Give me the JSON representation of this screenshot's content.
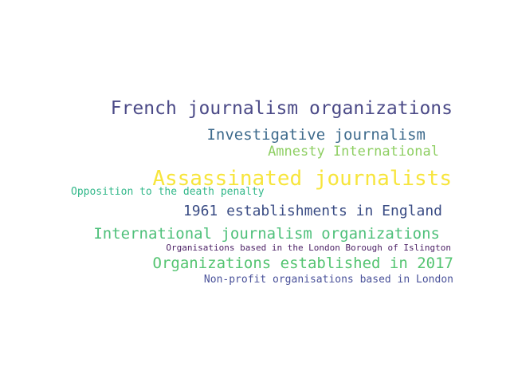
{
  "words": [
    {
      "text": "French journalism organizations",
      "color": "#4b4a87"
    },
    {
      "text": "Investigative journalism",
      "color": "#3d6a8c"
    },
    {
      "text": "Amnesty International",
      "color": "#8fcf64"
    },
    {
      "text": "Assassinated journalists",
      "color": "#f7e53c"
    },
    {
      "text": "Opposition to the death penalty",
      "color": "#33b88a"
    },
    {
      "text": "1961 establishments in England",
      "color": "#3a4c84"
    },
    {
      "text": "International journalism organizations",
      "color": "#4ec07a"
    },
    {
      "text": "Organisations based in the London Borough of Islington",
      "color": "#4a1f64"
    },
    {
      "text": "Organizations established in 2017",
      "color": "#54c471"
    },
    {
      "text": "Non-profit organisations based in London",
      "color": "#4a529a"
    }
  ]
}
